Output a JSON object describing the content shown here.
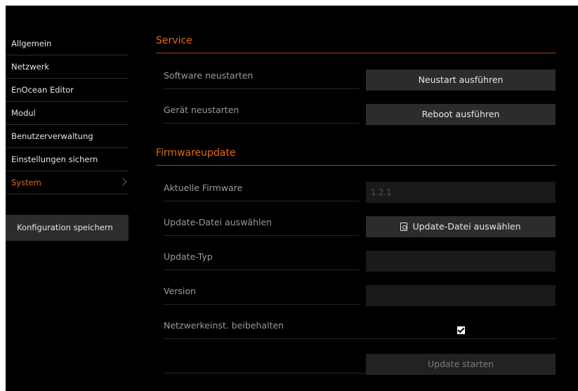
{
  "sidebar": {
    "items": [
      {
        "label": "Allgemein"
      },
      {
        "label": "Netzwerk"
      },
      {
        "label": "EnOcean Editor"
      },
      {
        "label": "Modul"
      },
      {
        "label": "Benutzerverwaltung"
      },
      {
        "label": "Einstellungen sichern"
      },
      {
        "label": "System"
      }
    ],
    "active": "System",
    "save_label": "Konfiguration speichern"
  },
  "service": {
    "title": "Service",
    "software_restart_label": "Software neustarten",
    "software_restart_button": "Neustart ausführen",
    "device_restart_label": "Gerät neustarten",
    "device_restart_button": "Reboot ausführen"
  },
  "firmware": {
    "title": "Firmwareupdate",
    "current_label": "Aktuelle Firmware",
    "current_value": "1.2.1",
    "file_label": "Update-Datei auswählen",
    "file_button": "Update-Datei auswählen",
    "type_label": "Update-Typ",
    "type_value": "",
    "version_label": "Version",
    "version_value": "",
    "keep_network_label": "Netzwerkeinst. beibehalten",
    "keep_network_checked": true,
    "start_button": "Update starten"
  },
  "colors": {
    "accent": "#e06a1c",
    "background": "#000000",
    "button": "#2c2c2c"
  },
  "icons": {
    "file_button_icon": "file-upload-icon",
    "sidebar_chevron": "chevron-right-icon"
  }
}
